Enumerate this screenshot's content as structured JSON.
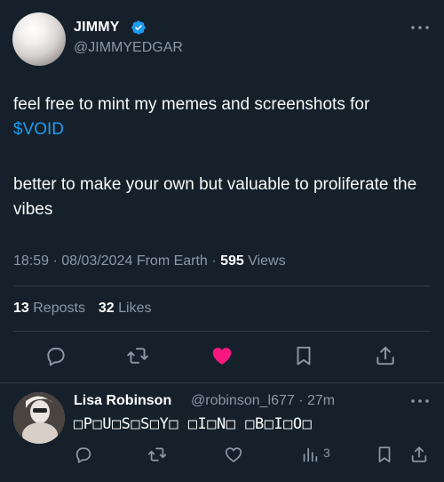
{
  "tweet": {
    "author_name": "JIMMY",
    "author_handle": "@JIMMYEDGAR",
    "para1_text": "feel free to mint my memes and screenshots for",
    "para1_link": "$VOID",
    "para2_text": "better to make your own but valuable to proliferate the vibes",
    "time": "18:59",
    "date": "08/03/2024",
    "source": "From Earth",
    "views_count": "595",
    "views_label": "Views",
    "reposts_count": "13",
    "reposts_label": "Reposts",
    "likes_count": "32",
    "likes_label": "Likes",
    "liked": true
  },
  "reply": {
    "author_name": "Lisa Robinson",
    "author_handle": "@robinson_l677",
    "age": "27m",
    "text": "□P□U□S□S□Y□ □I□N□ □B□I□O□",
    "views": "3"
  },
  "icons": {
    "verified": "verified-badge-icon",
    "reply": "comment-icon",
    "repost": "repost-icon",
    "like": "heart-icon",
    "bookmark": "bookmark-icon",
    "share": "share-icon",
    "more": "more-dots-icon",
    "views": "analytics-icon"
  },
  "colors": {
    "background": "#15202b",
    "accent": "#1d9bf0",
    "like": "#f91880",
    "muted": "#8b98a5"
  }
}
